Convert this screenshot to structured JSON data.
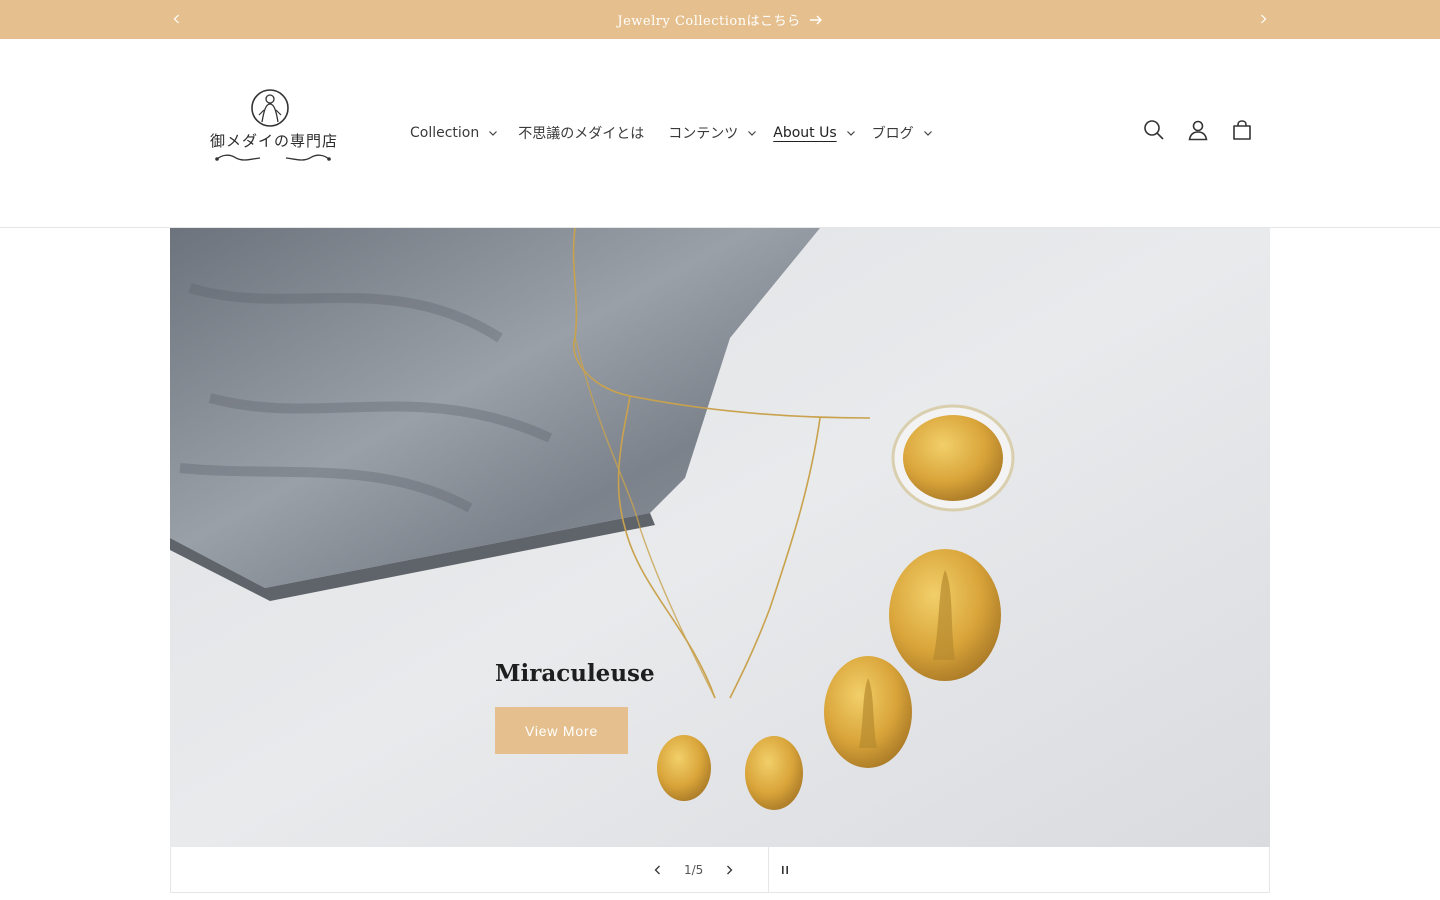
{
  "announcement": {
    "text": "Jewelry Collectionはこちら",
    "prev_icon": "chevron-left-icon",
    "next_icon": "chevron-right-icon"
  },
  "header": {
    "logo_text": "御メダイの専門店",
    "nav": [
      {
        "label": "Collection",
        "has_dropdown": true
      },
      {
        "label": "不思議のメダイとは",
        "has_dropdown": false
      },
      {
        "label": "コンテンツ",
        "has_dropdown": true
      },
      {
        "label": "About Us",
        "has_dropdown": true
      },
      {
        "label": "ブログ",
        "has_dropdown": true
      }
    ],
    "icons": [
      "search-icon",
      "account-icon",
      "cart-icon"
    ]
  },
  "hero": {
    "title": "Miraculeuse",
    "button_label": "View More"
  },
  "slider": {
    "counter": "1/5"
  },
  "colors": {
    "accent": "#e5c08e",
    "text": "#333333"
  }
}
